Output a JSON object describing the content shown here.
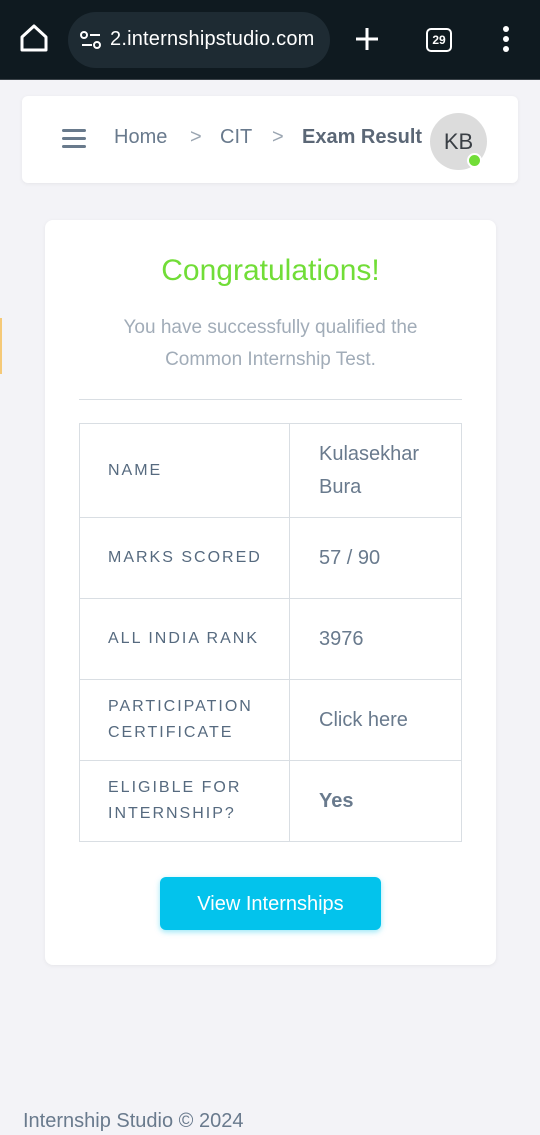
{
  "browser": {
    "url": "2.internshipstudio.com",
    "tab_count": "29"
  },
  "breadcrumb": {
    "home": "Home",
    "section": "CIT",
    "current": "Exam Result",
    "separator": ">"
  },
  "user": {
    "initials": "KB"
  },
  "result": {
    "heading": "Congratulations!",
    "message": "You have successfully qualified the Common Internship Test.",
    "rows": [
      {
        "label": "NAME",
        "value": "Kulasekhar Bura"
      },
      {
        "label": "MARKS SCORED",
        "value": "57 / 90"
      },
      {
        "label": "ALL INDIA RANK",
        "value": "3976"
      },
      {
        "label": "PARTICIPATION CERTIFICATE",
        "value": "Click here"
      },
      {
        "label": "ELIGIBLE FOR INTERNSHIP?",
        "value": "Yes"
      }
    ],
    "button_label": "View Internships"
  },
  "footer": {
    "text": "Internship Studio © 2024"
  },
  "colors": {
    "success": "#71dd37",
    "link": "#7367f0",
    "button": "#03c3ec"
  }
}
